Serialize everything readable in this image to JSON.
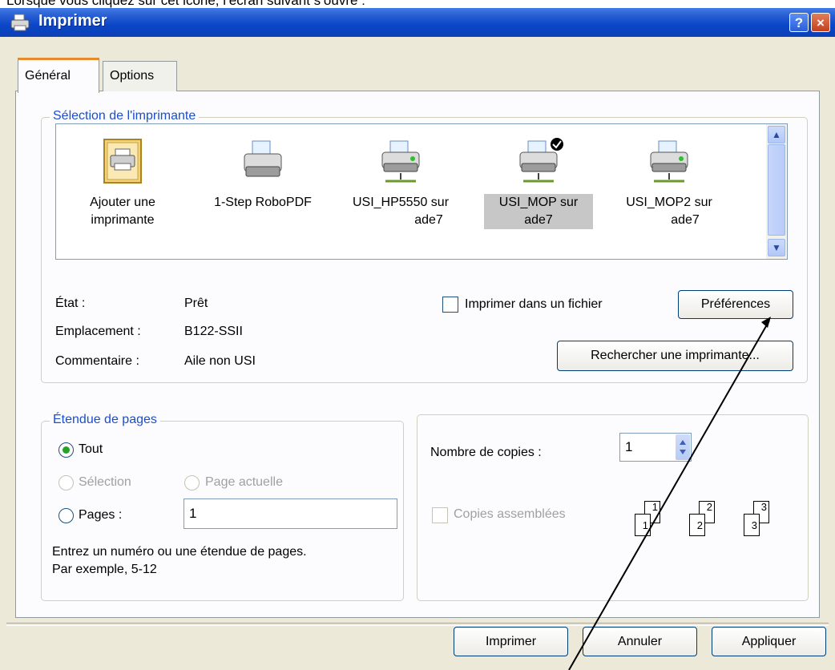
{
  "caption": "Lorsque vous cliquez sur cet icône, l’écran suivant s’ouvre :",
  "window": {
    "title": "Imprimer",
    "help_btn": "?",
    "close_btn": "×"
  },
  "tabs": {
    "general": "Général",
    "options": "Options"
  },
  "printer_selection": {
    "legend": "Sélection de l'imprimante",
    "printers": [
      {
        "line1": "Ajouter une",
        "line2": "imprimante",
        "icon": "add-printer-icon"
      },
      {
        "line1": "1-Step RoboPDF",
        "line2": "",
        "icon": "printer-icon"
      },
      {
        "line1": "USI_HP5550 sur",
        "line2": "ade7",
        "icon": "network-printer-icon"
      },
      {
        "line1": "USI_MOP sur",
        "line2": "ade7",
        "icon": "network-printer-default-icon",
        "selected": true
      },
      {
        "line1": "USI_MOP2 sur",
        "line2": "ade7",
        "icon": "network-printer-icon"
      }
    ],
    "status_label": "État :",
    "status_value": "Prêt",
    "location_label": "Emplacement :",
    "location_value": "B122-SSII",
    "comment_label": "Commentaire :",
    "comment_value": "Aile non USI",
    "print_to_file": "Imprimer dans un fichier",
    "preferences": "Préférences",
    "find_printer": "Rechercher une imprimante..."
  },
  "page_range": {
    "legend": "Étendue de pages",
    "all": "Tout",
    "selection": "Sélection",
    "current_page": "Page actuelle",
    "pages": "Pages :",
    "pages_value": "1",
    "hint_line1": "Entrez un numéro ou une étendue de pages.",
    "hint_line2": "Par exemple, 5-12"
  },
  "copies": {
    "label": "Nombre de copies :",
    "value": "1",
    "collate": "Copies assemblées",
    "collate_numbers": [
      "1",
      "1",
      "2",
      "2",
      "3",
      "3"
    ]
  },
  "buttons": {
    "print": "Imprimer",
    "cancel": "Annuler",
    "apply": "Appliquer"
  },
  "colors": {
    "titlebar": "#0a46c8",
    "legend": "#1a4ecc",
    "dialog_bg": "#ece9d8"
  }
}
